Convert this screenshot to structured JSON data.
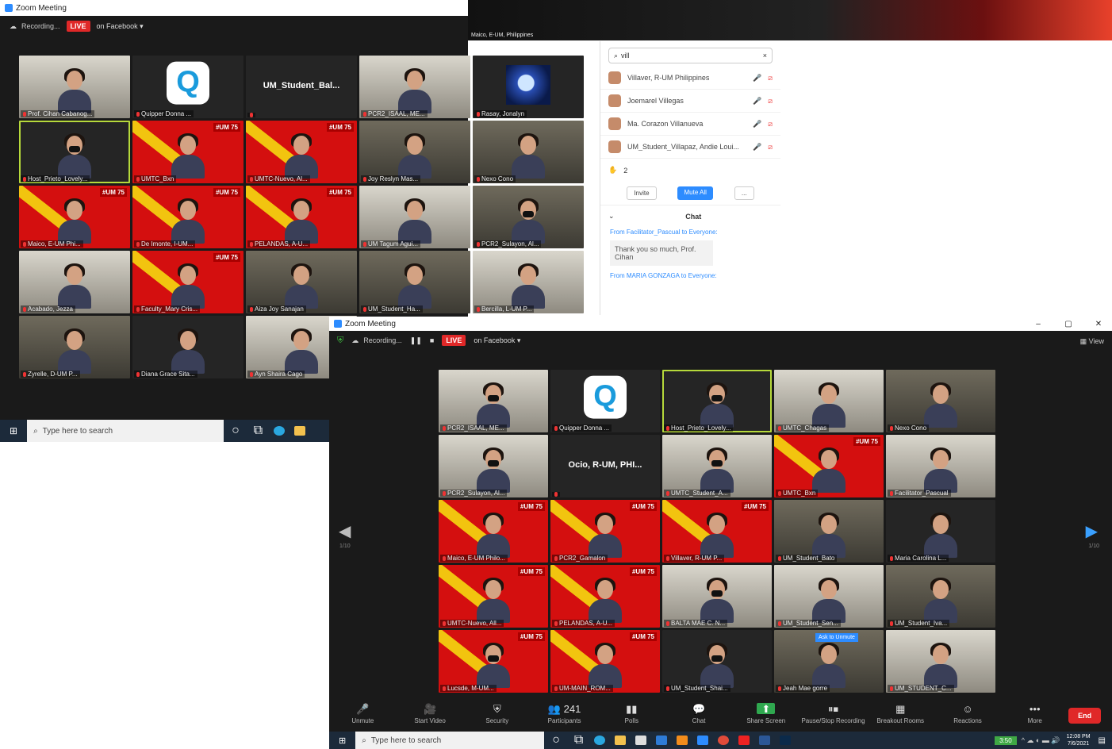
{
  "win1": {
    "title": "Zoom Meeting",
    "recording": "Recording...",
    "live": "LIVE",
    "facebook": "on Facebook",
    "tiles": [
      {
        "name": "Prof. Cihan Cabanog...",
        "kind": "banner"
      },
      {
        "name": "Quipper Donna ...",
        "kind": "quipper"
      },
      {
        "name": "",
        "kind": "bigname",
        "big": "UM_Student_Bal..."
      },
      {
        "name": "PCR2_ISAAL, ME...",
        "kind": "office"
      },
      {
        "name": "Rasay, Jonalyn",
        "kind": "moon"
      },
      {
        "name": "Host_Prieto_Lovely...",
        "kind": "plain",
        "active": true,
        "mask": true
      },
      {
        "name": "UMTC_Bxn",
        "kind": "red"
      },
      {
        "name": "UMTC-Nuevo, Al...",
        "kind": "red"
      },
      {
        "name": "Joy Reslyn Mas...",
        "kind": "room"
      },
      {
        "name": "Nexo Cono",
        "kind": "room"
      },
      {
        "name": "Maico, E-UM Phi...",
        "kind": "red"
      },
      {
        "name": "De Imonte, I-UM...",
        "kind": "red"
      },
      {
        "name": "PELANDAS, A-U...",
        "kind": "red"
      },
      {
        "name": "UM Tagum Agui...",
        "kind": "office"
      },
      {
        "name": "PCR2_Sulayon, Al...",
        "kind": "room",
        "mask": true
      },
      {
        "name": "Acabado, Jezza",
        "kind": "office"
      },
      {
        "name": "Faculty_Mary Cris...",
        "kind": "red"
      },
      {
        "name": "Aiza Joy Sanajan",
        "kind": "room"
      },
      {
        "name": "UM_Student_Ha...",
        "kind": "room"
      },
      {
        "name": "Bercilla, L-UM P...",
        "kind": "office"
      },
      {
        "name": "Zyrelle, D-UM P...",
        "kind": "room"
      },
      {
        "name": "Diana Grace Sita...",
        "kind": "plain"
      },
      {
        "name": "Ayn Shaira Cago",
        "kind": "office"
      }
    ],
    "taskbar_search": "Type here to search"
  },
  "top_right_label": "Maico, E-UM, Philippines",
  "panel": {
    "search": "vill",
    "participants": [
      {
        "name": "Villaver, R-UM Philippines"
      },
      {
        "name": "Joemarel Villegas"
      },
      {
        "name": "Ma. Corazon Villanueva"
      },
      {
        "name": "UM_Student_Villapaz, Andie Loui..."
      }
    ],
    "raised_count": "2",
    "invite": "Invite",
    "mute_all": "Mute All",
    "more": "...",
    "chat_title": "Chat",
    "msg1_from": "From Facilitator_Pascual to Everyone:",
    "msg1_text": "Thank you so much, Prof. Cihan",
    "msg2_from": "From MARIA GONZAGA to Everyone:"
  },
  "win2": {
    "title": "Zoom Meeting",
    "recording": "Recording...",
    "live": "LIVE",
    "facebook": "on Facebook",
    "view": "View",
    "page_left": "1/10",
    "page_right": "1/10",
    "tiles": [
      {
        "name": "PCR2_ISAAL, ME...",
        "kind": "office",
        "mask": true
      },
      {
        "name": "Quipper Donna ...",
        "kind": "quipper"
      },
      {
        "name": "Host_Prieto_Lovely...",
        "kind": "plain",
        "active": true,
        "mask": true
      },
      {
        "name": "UMTC_Chagas",
        "kind": "office"
      },
      {
        "name": "Nexo Cono",
        "kind": "room"
      },
      {
        "name": "PCR2_Sulayon, Al...",
        "kind": "office",
        "mask": true
      },
      {
        "name": "",
        "kind": "bigname",
        "big": "Ocio, R-UM, PHI..."
      },
      {
        "name": "UMTC_Student_A...",
        "kind": "office",
        "mask": true
      },
      {
        "name": "UMTC_Bxn",
        "kind": "red"
      },
      {
        "name": "Facilitator_Pascual",
        "kind": "office"
      },
      {
        "name": "Maico, E-UM Philo...",
        "kind": "red"
      },
      {
        "name": "PCR2_Gamalon",
        "kind": "red"
      },
      {
        "name": "Villaver, R-UM P...",
        "kind": "red"
      },
      {
        "name": "UM_Student_Bato",
        "kind": "room"
      },
      {
        "name": "Maria Carolina L...",
        "kind": "plain"
      },
      {
        "name": "UMTC-Nuevo, All...",
        "kind": "red"
      },
      {
        "name": "PELANDAS, A-U...",
        "kind": "red"
      },
      {
        "name": "BALTA MAE C. N...",
        "kind": "office",
        "mask": true
      },
      {
        "name": "UM_Student_Sen...",
        "kind": "office"
      },
      {
        "name": "UM_Student_Iva...",
        "kind": "room"
      },
      {
        "name": "Lucsde, M-UM...",
        "kind": "red",
        "mask": true
      },
      {
        "name": "UM-MAIN_ROM...",
        "kind": "red"
      },
      {
        "name": "UM_Student_Shai...",
        "kind": "plain",
        "mask": true
      },
      {
        "name": "Jeah Mae gorre",
        "kind": "room",
        "ask": "Ask to Unmute"
      },
      {
        "name": "UM_STUDENT_C...",
        "kind": "office"
      }
    ],
    "controls": [
      {
        "icon": "mic-off",
        "label": "Unmute",
        "glyph": "🎤"
      },
      {
        "icon": "video-off",
        "label": "Start Video",
        "glyph": "🎥"
      },
      {
        "icon": "shield",
        "label": "Security",
        "glyph": "⛨"
      },
      {
        "icon": "people",
        "label": "Participants",
        "glyph": "👥 241"
      },
      {
        "icon": "poll",
        "label": "Polls",
        "glyph": "▮▮"
      },
      {
        "icon": "chat",
        "label": "Chat",
        "glyph": "💬"
      },
      {
        "icon": "share",
        "label": "Share Screen",
        "glyph": "⬆"
      },
      {
        "icon": "pause-rec",
        "label": "Pause/Stop Recording",
        "glyph": "⏸⏹"
      },
      {
        "icon": "breakout",
        "label": "Breakout Rooms",
        "glyph": "▦"
      },
      {
        "icon": "reactions",
        "label": "Reactions",
        "glyph": "☺"
      },
      {
        "icon": "more",
        "label": "More",
        "glyph": "•••"
      }
    ],
    "end": "End",
    "taskbar_search": "Type here to search",
    "clock_time": "12:08 PM",
    "clock_date": "7/6/2021",
    "badge": "3:50"
  }
}
